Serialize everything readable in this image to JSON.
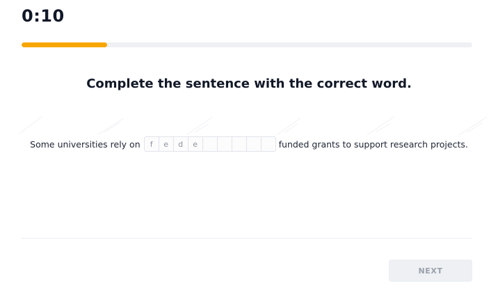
{
  "timer": {
    "text": "0:10"
  },
  "progress": {
    "fraction": 0.19,
    "color": "#f7a600"
  },
  "question": {
    "instruction": "Complete the sentence with the correct word.",
    "sentence_before": "Some universities rely on",
    "sentence_after": "funded grants to support research projects.",
    "letter_boxes": [
      "f",
      "e",
      "d",
      "e",
      "",
      "",
      "",
      "",
      ""
    ]
  },
  "footer": {
    "next_label": "NEXT"
  },
  "colors": {
    "accent": "#f7a600",
    "text": "#111827",
    "button_bg": "#eef0f3",
    "button_text": "#9aa1ac"
  }
}
